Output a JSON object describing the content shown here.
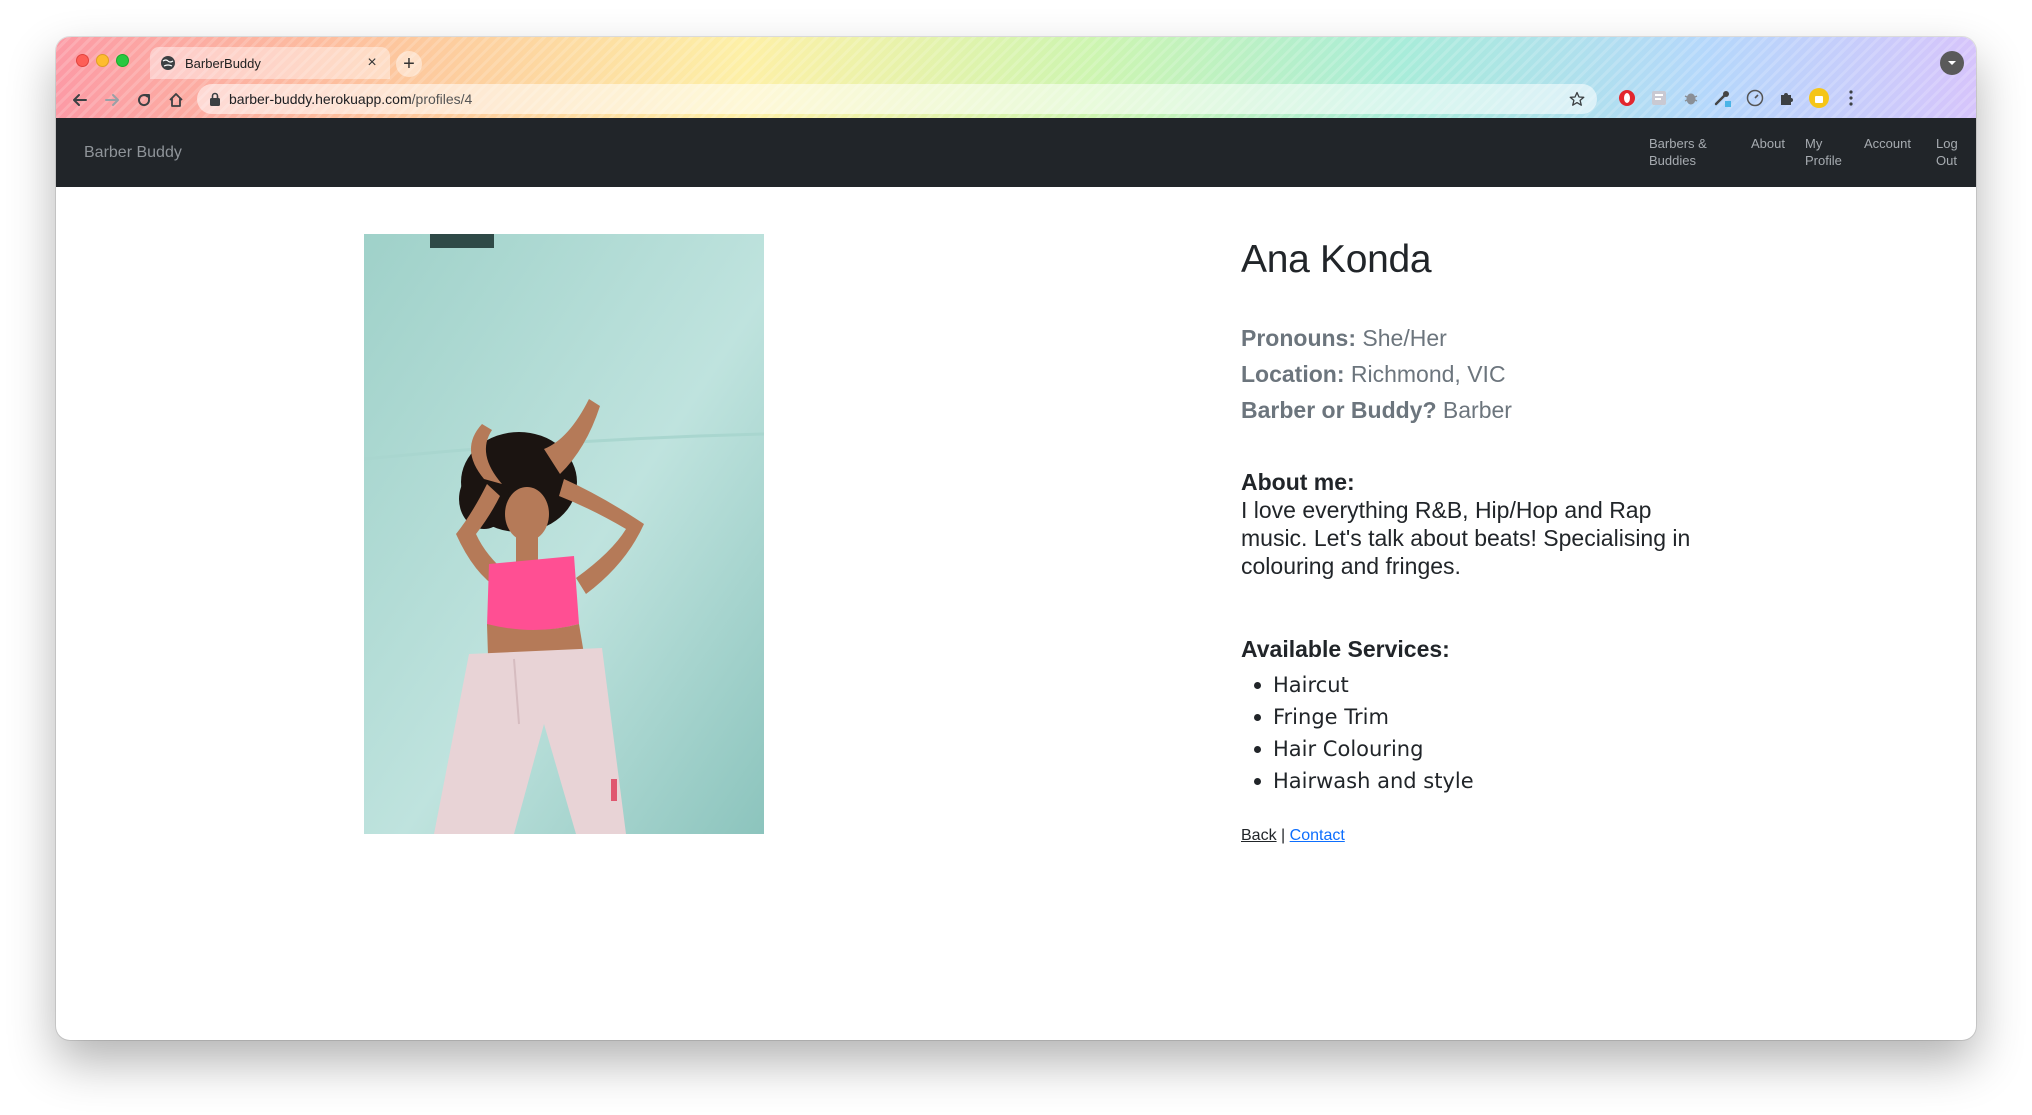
{
  "browser": {
    "tab_title": "BarberBuddy",
    "tab_close": "×",
    "new_tab": "+",
    "url_host": "barber-buddy.herokuapp.com",
    "url_path": "/profiles/4"
  },
  "navbar": {
    "brand": "Barber Buddy",
    "links": [
      "Barbers & Buddies",
      "About",
      "My Profile",
      "Account",
      "Log Out"
    ]
  },
  "profile": {
    "name": "Ana Konda",
    "pronouns_label": "Pronouns:",
    "pronouns": "She/Her",
    "location_label": "Location:",
    "location": "Richmond, VIC",
    "role_label": "Barber or Buddy?",
    "role": "Barber",
    "about_label": "About me:",
    "about": "I love everything R&B, Hip/Hop and Rap music. Let's talk about beats! Specialising in colouring and fringes.",
    "services_label": "Available Services:",
    "services": [
      "Haircut",
      "Fringe Trim",
      "Hair Colouring",
      "Hairwash and style"
    ],
    "back_link": "Back",
    "separator": "|",
    "contact_link": "Contact"
  },
  "colors": {
    "navbar_bg": "#212529",
    "link_blue": "#0d6efd",
    "muted_text": "#6c757d",
    "top_pink": "#ff4f93",
    "pants": "#e8d3d6",
    "wall": "#b9e0db"
  }
}
